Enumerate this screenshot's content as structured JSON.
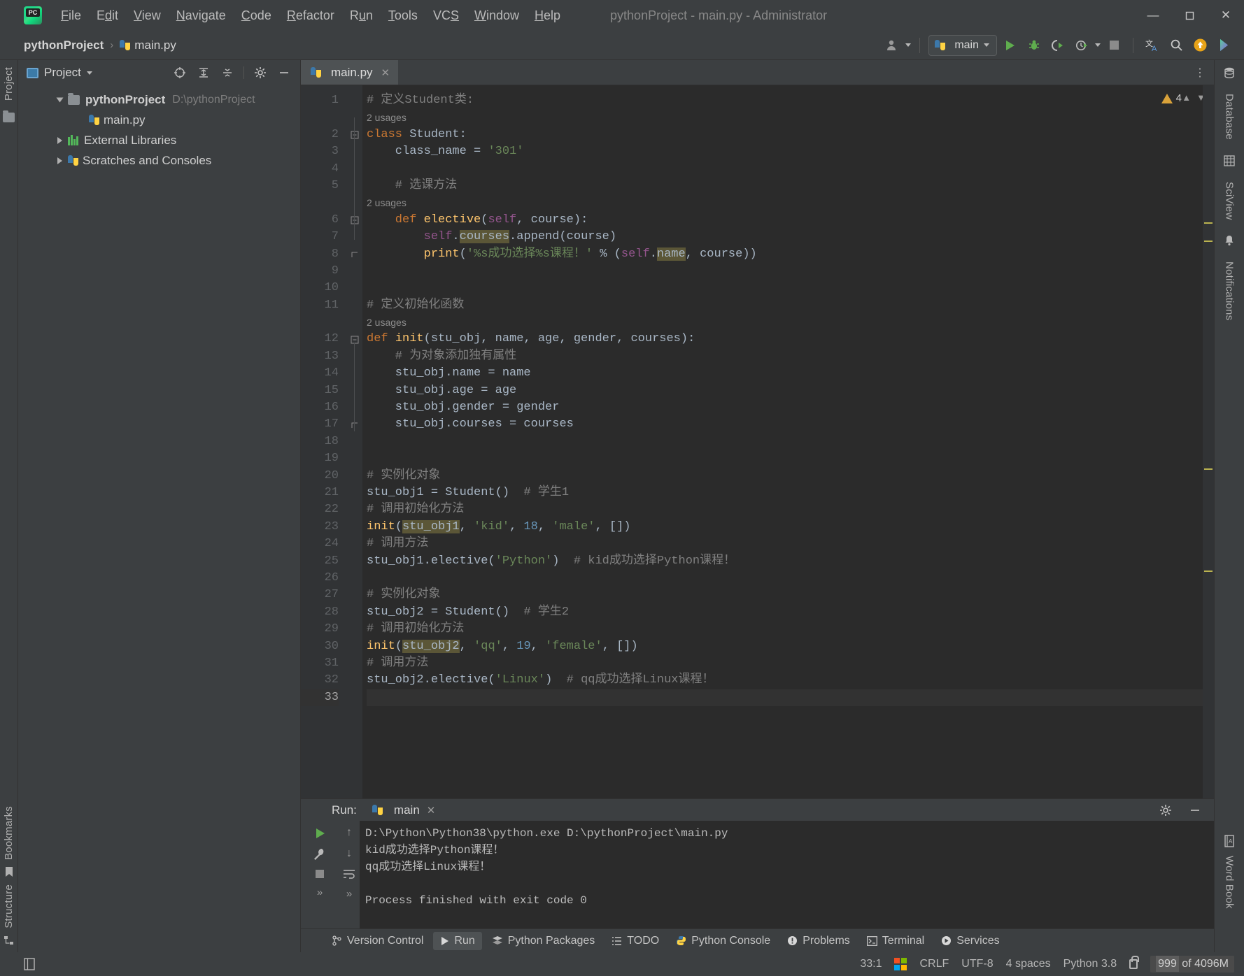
{
  "window": {
    "title": "pythonProject - main.py - Administrator",
    "minimize": "—",
    "maximize": "☐",
    "close": "✕"
  },
  "menu": {
    "items": [
      "File",
      "Edit",
      "View",
      "Navigate",
      "Code",
      "Refactor",
      "Run",
      "Tools",
      "VCS",
      "Window",
      "Help"
    ]
  },
  "breadcrumb": {
    "project": "pythonProject",
    "separator": "›",
    "file": "main.py"
  },
  "toolbar": {
    "run_config": "main",
    "run_label": "Run",
    "debug_label": "Debug",
    "coverage_label": "Run with Coverage",
    "profile_label": "Profile",
    "stop_label": "Stop",
    "translate_label": "Translate",
    "search_label": "Search Everywhere",
    "update_label": "Update Project",
    "share_label": "Share"
  },
  "project_panel": {
    "title": "Project",
    "tree": [
      {
        "label": "pythonProject",
        "path": "D:\\pythonProject",
        "level": 0,
        "expanded": true,
        "kind": "folder"
      },
      {
        "label": "main.py",
        "path": "",
        "level": 1,
        "expanded": false,
        "kind": "python"
      },
      {
        "label": "External Libraries",
        "path": "",
        "level": 0,
        "expanded": false,
        "kind": "library"
      },
      {
        "label": "Scratches and Consoles",
        "path": "",
        "level": 0,
        "expanded": false,
        "kind": "scratch"
      }
    ]
  },
  "editor": {
    "tab": "main.py",
    "warning_count": "4",
    "lines": [
      {
        "n": "1",
        "segs": [
          [
            "cmt",
            "# 定义Student类:"
          ]
        ]
      },
      {
        "n": "",
        "info": "2 usages"
      },
      {
        "n": "2",
        "segs": [
          [
            "kw",
            "class "
          ],
          [
            "id",
            "Student:"
          ]
        ],
        "fold": "open"
      },
      {
        "n": "3",
        "segs": [
          [
            "id",
            "    class_name "
          ],
          [
            "id",
            "= "
          ],
          [
            "str",
            "'301'"
          ]
        ]
      },
      {
        "n": "4",
        "segs": []
      },
      {
        "n": "5",
        "segs": [
          [
            "cmt",
            "    # 选课方法"
          ]
        ]
      },
      {
        "n": "",
        "info": "2 usages"
      },
      {
        "n": "6",
        "segs": [
          [
            "kw",
            "    def "
          ],
          [
            "fn",
            "elective"
          ],
          [
            "id",
            "("
          ],
          [
            "self",
            "self"
          ],
          [
            "id",
            ", course):"
          ]
        ],
        "fold": "open"
      },
      {
        "n": "7",
        "segs": [
          [
            "self",
            "        self"
          ],
          [
            "id",
            "."
          ],
          [
            "hl",
            "courses"
          ],
          [
            "id",
            ".append(course)"
          ]
        ]
      },
      {
        "n": "8",
        "segs": [
          [
            "id",
            "        "
          ],
          [
            "fn",
            "print"
          ],
          [
            "id",
            "("
          ],
          [
            "str",
            "'%s成功选择%s课程！'"
          ],
          [
            "id",
            " % ("
          ],
          [
            "self",
            "self"
          ],
          [
            "id",
            "."
          ],
          [
            "hl",
            "name"
          ],
          [
            "id",
            ", course))"
          ]
        ],
        "fold": "end"
      },
      {
        "n": "9",
        "segs": []
      },
      {
        "n": "10",
        "segs": []
      },
      {
        "n": "11",
        "segs": [
          [
            "cmt",
            "# 定义初始化函数"
          ]
        ]
      },
      {
        "n": "",
        "info": "2 usages"
      },
      {
        "n": "12",
        "segs": [
          [
            "kw",
            "def "
          ],
          [
            "fn",
            "init"
          ],
          [
            "id",
            "(stu_obj, name, age, gender, courses):"
          ]
        ],
        "fold": "open"
      },
      {
        "n": "13",
        "segs": [
          [
            "cmt",
            "    # 为对象添加独有属性"
          ]
        ]
      },
      {
        "n": "14",
        "segs": [
          [
            "id",
            "    stu_obj.name = name"
          ]
        ]
      },
      {
        "n": "15",
        "segs": [
          [
            "id",
            "    stu_obj.age = age"
          ]
        ]
      },
      {
        "n": "16",
        "segs": [
          [
            "id",
            "    stu_obj.gender = gender"
          ]
        ]
      },
      {
        "n": "17",
        "segs": [
          [
            "id",
            "    stu_obj.courses = courses"
          ]
        ],
        "fold": "end"
      },
      {
        "n": "18",
        "segs": []
      },
      {
        "n": "19",
        "segs": []
      },
      {
        "n": "20",
        "segs": [
          [
            "cmt",
            "# 实例化对象"
          ]
        ]
      },
      {
        "n": "21",
        "segs": [
          [
            "id",
            "stu_obj1 = Student()  "
          ],
          [
            "cmt",
            "# 学生1"
          ]
        ]
      },
      {
        "n": "22",
        "segs": [
          [
            "cmt",
            "# 调用初始化方法"
          ]
        ]
      },
      {
        "n": "23",
        "segs": [
          [
            "fn",
            "init"
          ],
          [
            "id",
            "("
          ],
          [
            "hl",
            "stu_obj1"
          ],
          [
            "id",
            ", "
          ],
          [
            "str",
            "'kid'"
          ],
          [
            "id",
            ", "
          ],
          [
            "num",
            "18"
          ],
          [
            "id",
            ", "
          ],
          [
            "str",
            "'male'"
          ],
          [
            "id",
            ", [])"
          ]
        ]
      },
      {
        "n": "24",
        "segs": [
          [
            "cmt",
            "# 调用方法"
          ]
        ]
      },
      {
        "n": "25",
        "segs": [
          [
            "id",
            "stu_obj1.elective("
          ],
          [
            "str",
            "'Python'"
          ],
          [
            "id",
            ")  "
          ],
          [
            "cmt",
            "# kid成功选择Python课程！"
          ]
        ]
      },
      {
        "n": "26",
        "segs": []
      },
      {
        "n": "27",
        "segs": [
          [
            "cmt",
            "# 实例化对象"
          ]
        ]
      },
      {
        "n": "28",
        "segs": [
          [
            "id",
            "stu_obj2 = Student()  "
          ],
          [
            "cmt",
            "# 学生2"
          ]
        ]
      },
      {
        "n": "29",
        "segs": [
          [
            "cmt",
            "# 调用初始化方法"
          ]
        ]
      },
      {
        "n": "30",
        "segs": [
          [
            "fn",
            "init"
          ],
          [
            "id",
            "("
          ],
          [
            "hl",
            "stu_obj2"
          ],
          [
            "id",
            ", "
          ],
          [
            "str",
            "'qq'"
          ],
          [
            "id",
            ", "
          ],
          [
            "num",
            "19"
          ],
          [
            "id",
            ", "
          ],
          [
            "str",
            "'female'"
          ],
          [
            "id",
            ", [])"
          ]
        ]
      },
      {
        "n": "31",
        "segs": [
          [
            "cmt",
            "# 调用方法"
          ]
        ]
      },
      {
        "n": "32",
        "segs": [
          [
            "id",
            "stu_obj2.elective("
          ],
          [
            "str",
            "'Linux'"
          ],
          [
            "id",
            ")  "
          ],
          [
            "cmt",
            "# qq成功选择Linux课程！"
          ]
        ]
      },
      {
        "n": "33",
        "segs": [],
        "current": true
      }
    ]
  },
  "run_panel": {
    "label": "Run:",
    "tab": "main",
    "console": [
      "D:\\Python\\Python38\\python.exe D:\\pythonProject\\main.py",
      "kid成功选择Python课程！",
      "qq成功选择Linux课程！",
      "",
      "Process finished with exit code 0"
    ]
  },
  "tool_window_bar": {
    "items": [
      {
        "label": "Version Control",
        "icon": "branch-icon",
        "active": false
      },
      {
        "label": "Run",
        "icon": "play-icon",
        "active": true
      },
      {
        "label": "Python Packages",
        "icon": "packages-icon",
        "active": false
      },
      {
        "label": "TODO",
        "icon": "list-icon",
        "active": false
      },
      {
        "label": "Python Console",
        "icon": "python-icon",
        "active": false
      },
      {
        "label": "Problems",
        "icon": "warning-circle-icon",
        "active": false
      },
      {
        "label": "Terminal",
        "icon": "terminal-icon",
        "active": false
      },
      {
        "label": "Services",
        "icon": "services-icon",
        "active": false
      }
    ]
  },
  "left_rail": {
    "top_label": "Project",
    "bottom_labels": [
      "Bookmarks",
      "Structure"
    ]
  },
  "right_rail": {
    "labels": [
      "Database",
      "SciView",
      "Notifications"
    ],
    "bottom_label": "Word Book"
  },
  "status_bar": {
    "caret": "33:1",
    "line_sep": "CRLF",
    "encoding": "UTF-8",
    "indent": "4 spaces",
    "interpreter": "Python 3.8",
    "memory_used": "999",
    "memory_total": " of 4096M"
  },
  "colors": {
    "accent_green": "#5fad4e",
    "warning": "#d9a23a",
    "keyword": "#cc7832",
    "string": "#6a8759",
    "number": "#6897bb",
    "function": "#ffc66d",
    "comment": "#808080",
    "highlight": "#5b5637"
  }
}
